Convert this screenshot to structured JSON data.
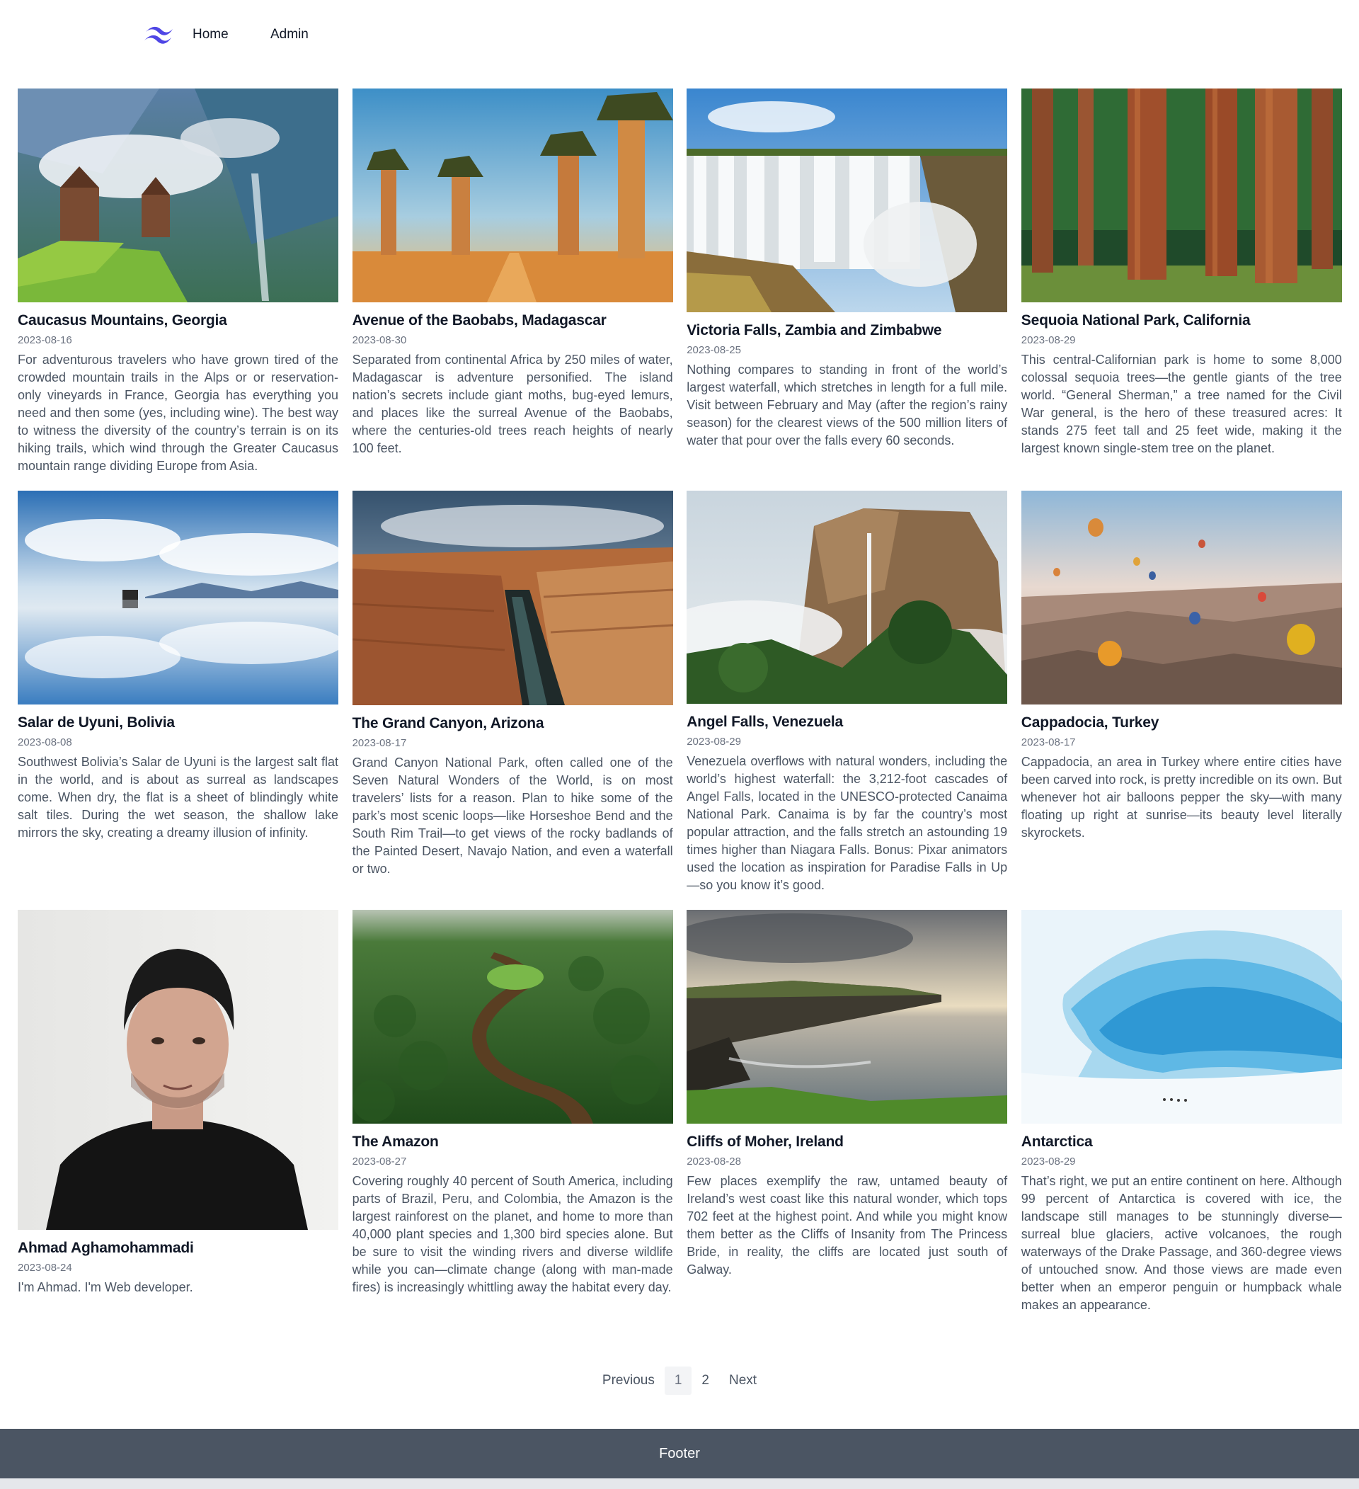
{
  "nav": {
    "home": "Home",
    "admin": "Admin"
  },
  "posts": [
    {
      "title": "Caucasus Mountains, Georgia",
      "date": "2023-08-16",
      "text": "For adventurous travelers who have grown tired of the crowded mountain trails in the Alps or or reservation-only vineyards in France, Georgia has everything you need and then some (yes, including wine). The best way to witness the diversity of the country’s terrain is on its hiking trails, which wind through the Greater Caucasus mountain range dividing Europe from Asia.",
      "image": "caucasus-mountains-photo"
    },
    {
      "title": "Avenue of the Baobabs, Madagascar",
      "date": "2023-08-30",
      "text": "Separated from continental Africa by 250 miles of water, Madagascar is adventure personified. The island nation’s secrets include giant moths, bug-eyed lemurs, and places like the surreal Avenue of the Baobabs, where the centuries-old trees reach heights of nearly 100 feet.",
      "image": "baobab-avenue-photo"
    },
    {
      "title": "Victoria Falls, Zambia and Zimbabwe",
      "date": "2023-08-25",
      "text": "Nothing compares to standing in front of the world’s largest waterfall, which stretches in length for a full mile. Visit between February and May (after the region’s rainy season) for the clearest views of the 500 million liters of water that pour over the falls every 60 seconds.",
      "image": "victoria-falls-photo"
    },
    {
      "title": "Sequoia National Park, California",
      "date": "2023-08-29",
      "text": "This central-Californian park is home to some 8,000 colossal sequoia trees—the gentle giants of the tree world. “General Sherman,” a tree named for the Civil War general, is the hero of these treasured acres: It stands 275 feet tall and 25 feet wide, making it the largest known single-stem tree on the planet.",
      "image": "sequoia-forest-photo"
    },
    {
      "title": "Salar de Uyuni, Bolivia",
      "date": "2023-08-08",
      "text": "Southwest Bolivia’s Salar de Uyuni is the largest salt flat in the world, and is about as surreal as landscapes come. When dry, the flat is a sheet of blindingly white salt tiles. During the wet season, the shallow lake mirrors the sky, creating a dreamy illusion of infinity.",
      "image": "salt-flat-photo"
    },
    {
      "title": "The Grand Canyon, Arizona",
      "date": "2023-08-17",
      "text": "Grand Canyon National Park, often called one of the Seven Natural Wonders of the World, is on most travelers’ lists for a reason. Plan to hike some of the park’s most scenic loops—like Horseshoe Bend and the South Rim Trail—to get views of the rocky badlands of the Painted Desert, Navajo Nation, and even a waterfall or two.",
      "image": "grand-canyon-photo"
    },
    {
      "title": "Angel Falls, Venezuela",
      "date": "2023-08-29",
      "text": "Venezuela overflows with natural wonders, including the world’s highest waterfall: the 3,212-foot cascades of Angel Falls, located in the UNESCO-protected Canaima National Park. Canaima is by far the country’s most popular attraction, and the falls stretch an astounding 19 times higher than Niagara Falls. Bonus: Pixar animators used the location as inspiration for Paradise Falls in Up—so you know it’s good.",
      "image": "angel-falls-photo"
    },
    {
      "title": "Cappadocia, Turkey",
      "date": "2023-08-17",
      "text": "Cappadocia, an area in Turkey where entire cities have been carved into rock, is pretty incredible on its own. But whenever hot air balloons pepper the sky—with many floating up right at sunrise—its beauty level literally skyrockets.",
      "image": "cappadocia-balloons-photo"
    },
    {
      "title": "Ahmad Aghamohammadi",
      "date": "2023-08-24",
      "text": "I'm Ahmad. I'm Web developer.",
      "image": "portrait-photo"
    },
    {
      "title": "The Amazon",
      "date": "2023-08-27",
      "text": "Covering roughly 40 percent of South America, including parts of Brazil, Peru, and Colombia, the Amazon is the largest rainforest on the planet, and home to more than 40,000 plant species and 1,300 bird species alone. But be sure to visit the winding rivers and diverse wildlife while you can—climate change (along with man-made fires) is increasingly whittling away the habitat every day.",
      "image": "amazon-river-photo"
    },
    {
      "title": "Cliffs of Moher, Ireland",
      "date": "2023-08-28",
      "text": "Few places exemplify the raw, untamed beauty of Ireland’s west coast like this natural wonder, which tops 702 feet at the highest point. And while you might know them better as the Cliffs of Insanity from The Princess Bride, in reality, the cliffs are located just south of Galway.",
      "image": "sea-cliffs-photo"
    },
    {
      "title": "Antarctica",
      "date": "2023-08-29",
      "text": "That’s right, we put an entire continent on here. Although 99 percent of Antarctica is covered with ice, the landscape still manages to be stunningly diverse—surreal blue glaciers, active volcanoes, the rough waterways of the Drake Passage, and 360-degree views of untouched snow. And those views are made even better when an emperor penguin or humpback whale makes an appearance.",
      "image": "glacier-ice-photo"
    }
  ],
  "pagination": {
    "previous": "Previous",
    "pages": [
      "1",
      "2"
    ],
    "current": "1",
    "next": "Next"
  },
  "footer": {
    "text": "Footer"
  },
  "colors": {
    "accent": "#4f46e5",
    "footer_bg": "#4b5563"
  }
}
